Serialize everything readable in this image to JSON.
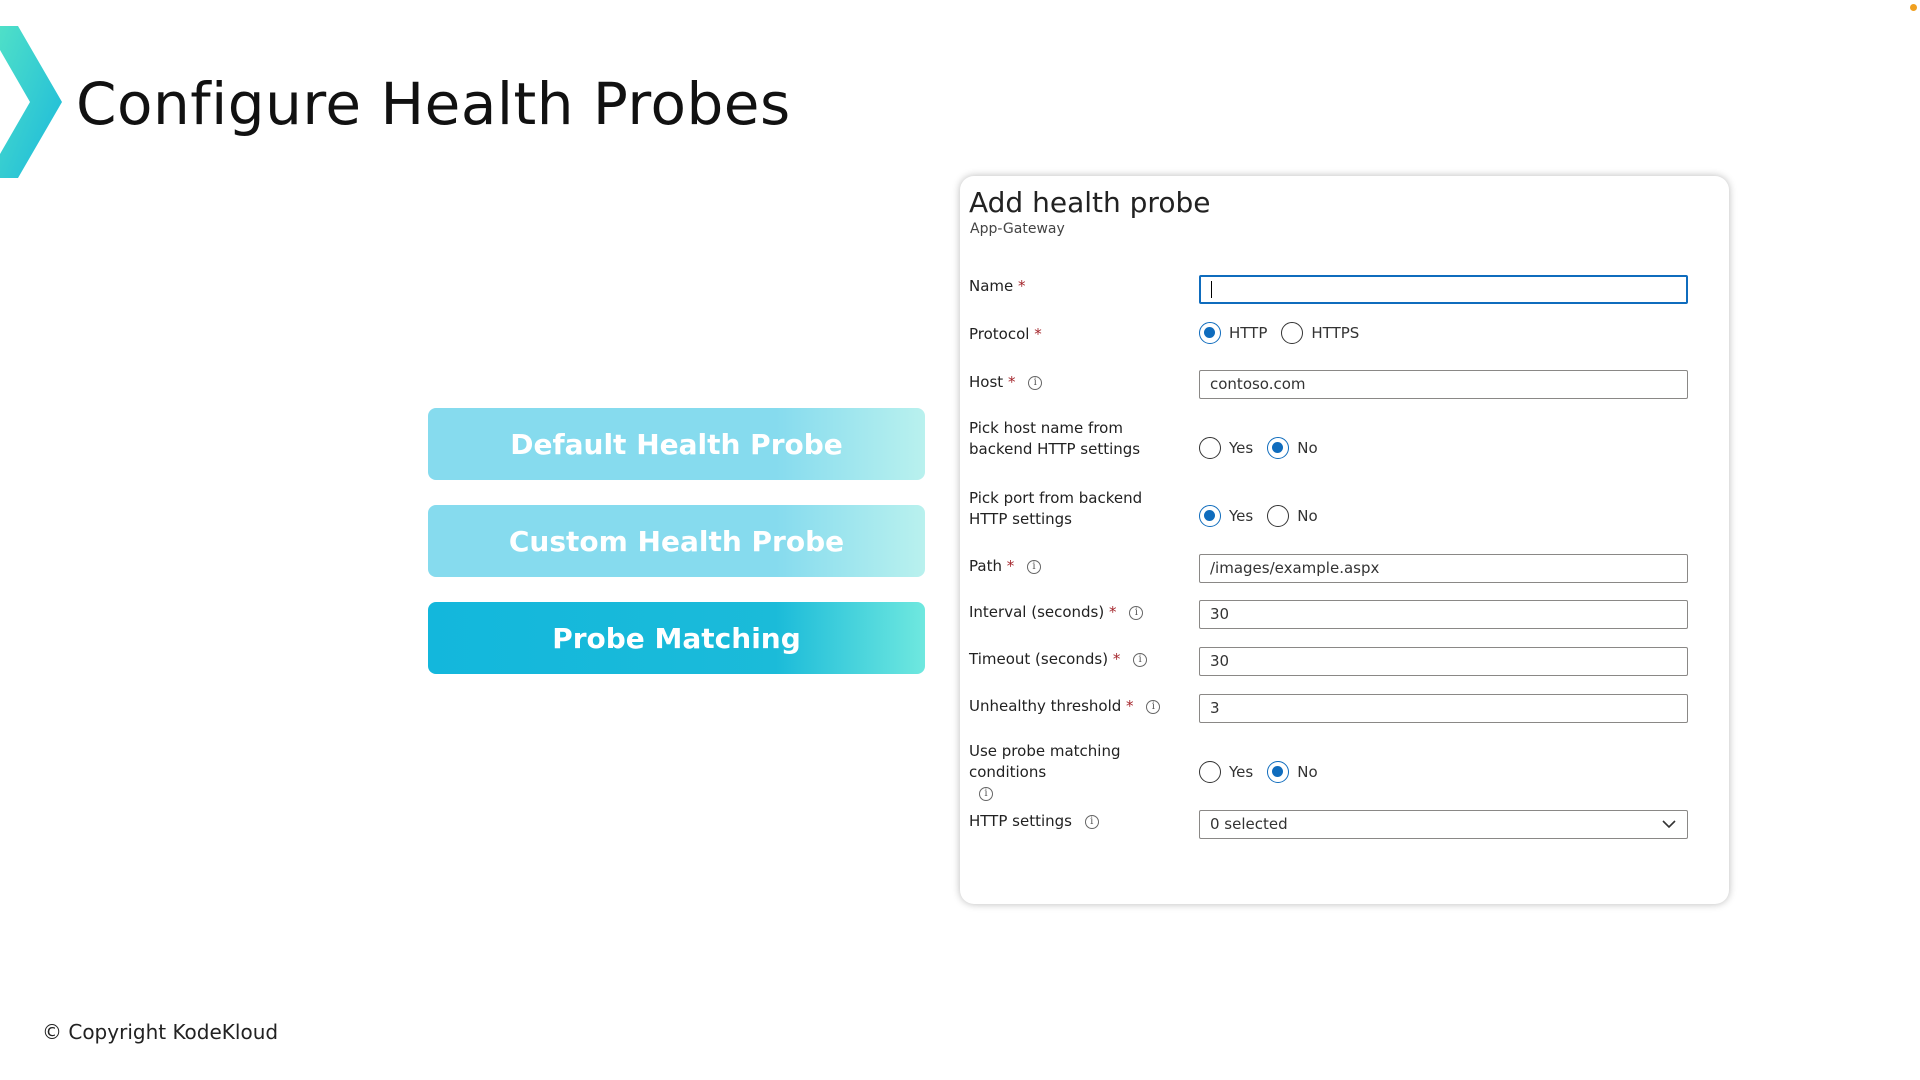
{
  "slide": {
    "title": "Configure Health Probes",
    "copyright": "© Copyright KodeKloud",
    "accent_color": "#1ab8dc"
  },
  "topics": [
    {
      "label": "Default Health Probe",
      "active": false
    },
    {
      "label": "Custom Health Probe",
      "active": false
    },
    {
      "label": "Probe Matching",
      "active": true
    }
  ],
  "panel": {
    "title": "Add health probe",
    "subtitle": "App-Gateway",
    "fields": {
      "name": {
        "label": "Name",
        "value": ""
      },
      "protocol": {
        "label": "Protocol",
        "options": [
          "HTTP",
          "HTTPS"
        ],
        "selected": "HTTP"
      },
      "host": {
        "label": "Host",
        "value": "contoso.com"
      },
      "pick_host": {
        "label": "Pick host name from backend HTTP settings",
        "options": [
          "Yes",
          "No"
        ],
        "selected": "No"
      },
      "pick_port": {
        "label": "Pick port from backend HTTP settings",
        "options": [
          "Yes",
          "No"
        ],
        "selected": "Yes"
      },
      "path": {
        "label": "Path",
        "value": "/images/example.aspx"
      },
      "interval": {
        "label": "Interval (seconds)",
        "value": "30"
      },
      "timeout": {
        "label": "Timeout (seconds)",
        "value": "30"
      },
      "unhealthy": {
        "label": "Unhealthy threshold",
        "value": "3"
      },
      "probe_matching": {
        "label": "Use probe matching conditions",
        "options": [
          "Yes",
          "No"
        ],
        "selected": "No"
      },
      "http_settings": {
        "label": "HTTP settings",
        "value": "0 selected"
      }
    },
    "required_marker": "*",
    "info_icon": "i"
  }
}
